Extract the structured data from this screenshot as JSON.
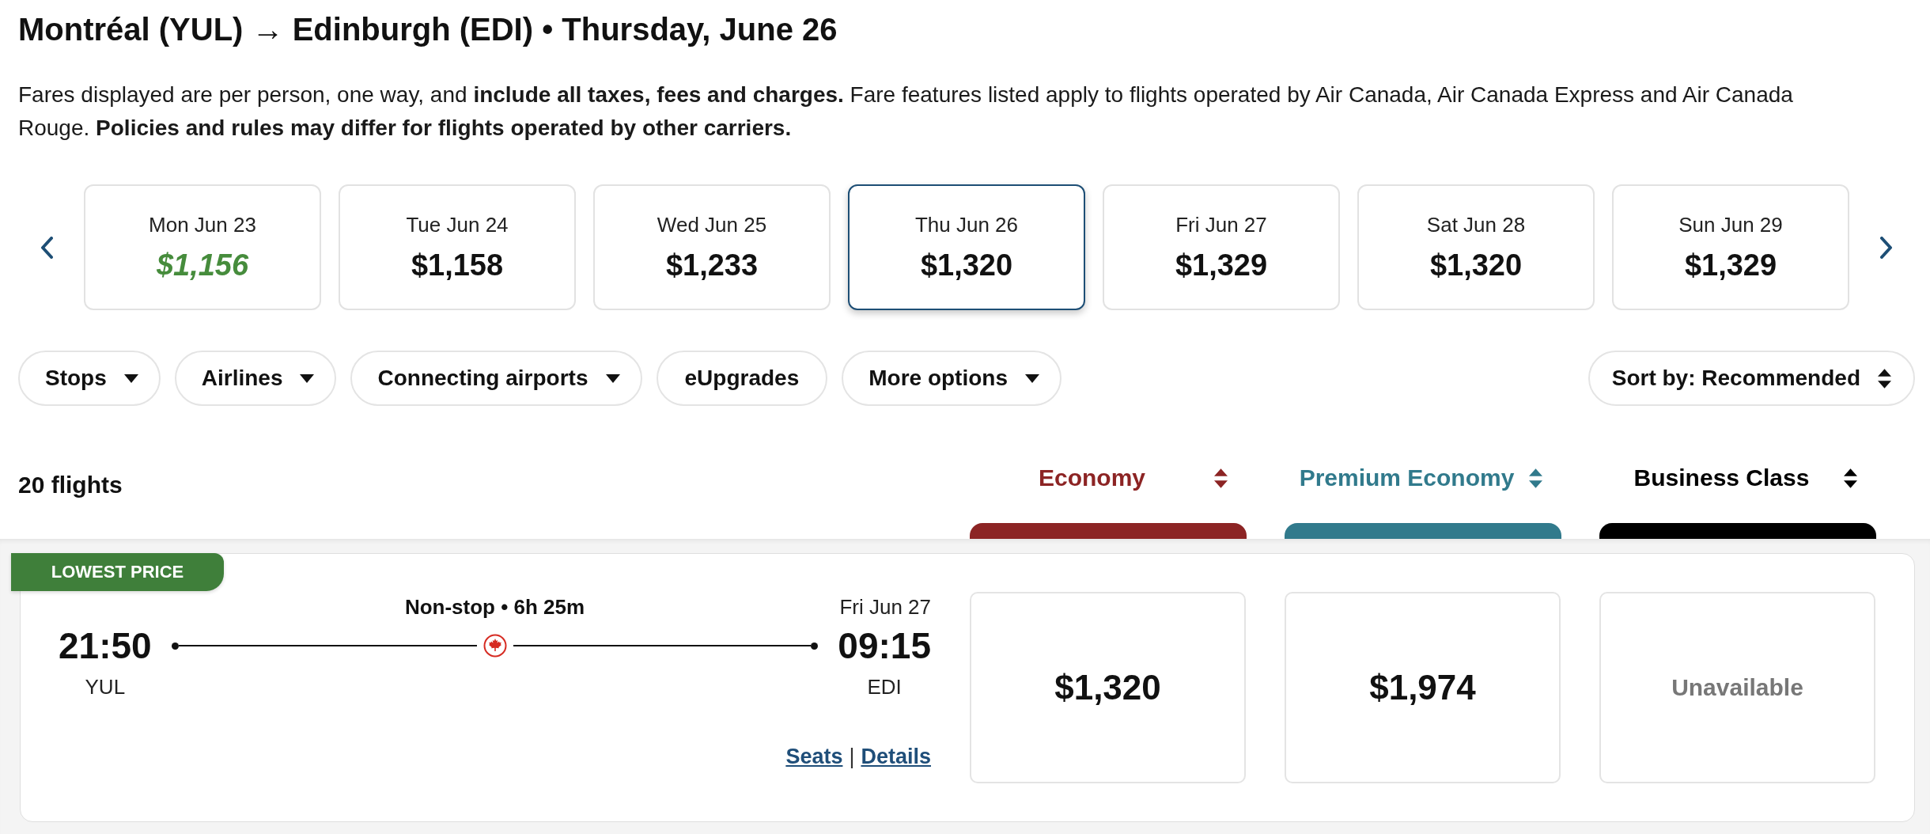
{
  "header": {
    "title": "Montréal (YUL) → Edinburgh (EDI) • Thursday, June 26",
    "disclaimer": "Fares displayed are per person, one way, and **include all taxes, fees and charges.** Fare features listed apply to flights operated by Air Canada, Air Canada Express and Air Canada Rouge. **Policies and rules may differ for flights operated by other carriers.**"
  },
  "date_carousel": {
    "days": [
      {
        "label": "Mon Jun 23",
        "price": "$1,156",
        "selected": false,
        "lowest": true
      },
      {
        "label": "Tue Jun 24",
        "price": "$1,158",
        "selected": false,
        "lowest": false
      },
      {
        "label": "Wed Jun 25",
        "price": "$1,233",
        "selected": false,
        "lowest": false
      },
      {
        "label": "Thu Jun 26",
        "price": "$1,320",
        "selected": true,
        "lowest": false
      },
      {
        "label": "Fri Jun 27",
        "price": "$1,329",
        "selected": false,
        "lowest": false
      },
      {
        "label": "Sat Jun 28",
        "price": "$1,320",
        "selected": false,
        "lowest": false
      },
      {
        "label": "Sun Jun 29",
        "price": "$1,329",
        "selected": false,
        "lowest": false
      }
    ]
  },
  "filters": {
    "items": [
      {
        "label": "Stops",
        "dropdown": true
      },
      {
        "label": "Airlines",
        "dropdown": true
      },
      {
        "label": "Connecting airports",
        "dropdown": true
      },
      {
        "label": "eUpgrades",
        "dropdown": false
      },
      {
        "label": "More options",
        "dropdown": true
      }
    ],
    "sort": {
      "label": "Sort by: Recommended"
    }
  },
  "results": {
    "count": "20 flights",
    "cabins": [
      {
        "name": "Economy",
        "color": "#8c2424"
      },
      {
        "name": "Premium Economy",
        "color": "#317a8c"
      },
      {
        "name": "Business Class",
        "color": "#000000"
      }
    ]
  },
  "flights": [
    {
      "badge": "LOWEST PRICE",
      "departure": {
        "time": "21:50",
        "airport": "YUL"
      },
      "summary": "Non-stop • 6h 25m",
      "arrival": {
        "date": "Fri Jun 27",
        "time": "09:15",
        "airport": "EDI"
      },
      "links": [
        "Seats",
        "Details"
      ],
      "link_separator": "|",
      "fares": [
        {
          "kind": "price",
          "text": "$1,320"
        },
        {
          "kind": "price",
          "text": "$1,974"
        },
        {
          "kind": "unavailable",
          "text": "Unavailable"
        }
      ]
    }
  ]
}
